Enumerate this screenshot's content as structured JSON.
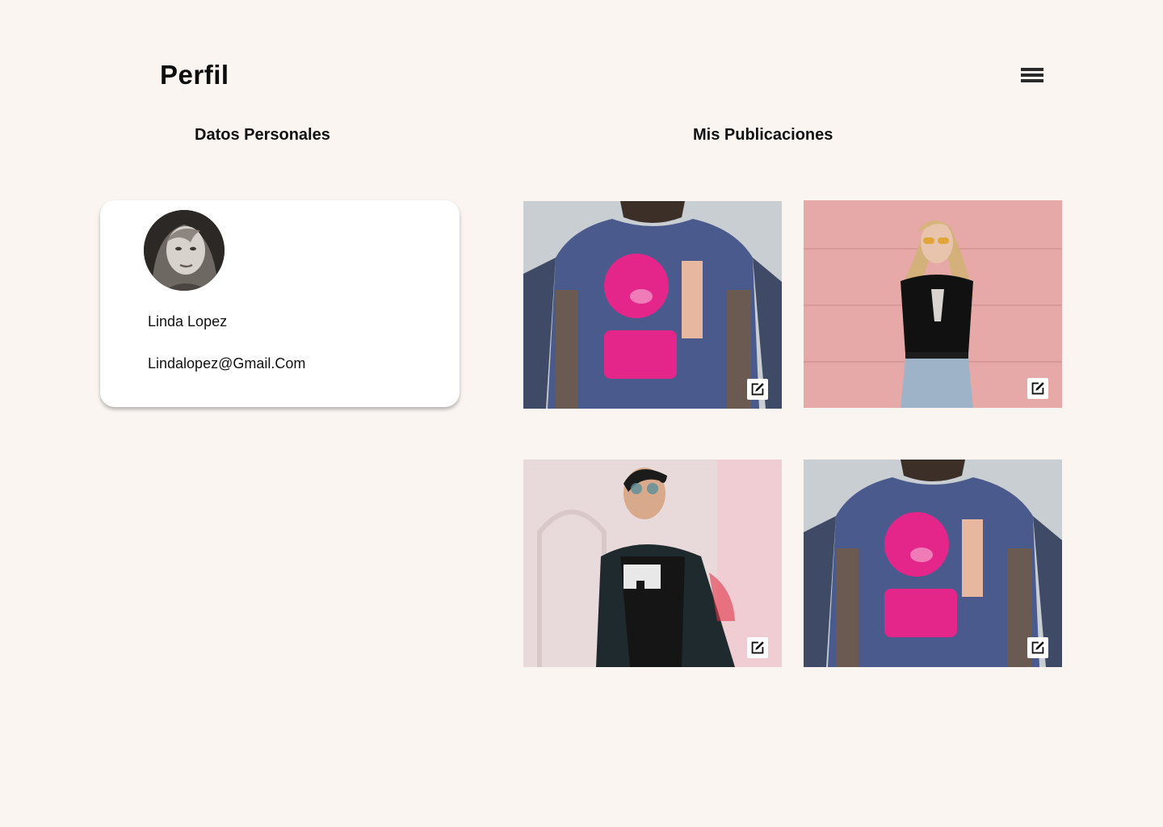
{
  "header": {
    "title": "Perfil",
    "menu_icon": "hamburger-menu-icon"
  },
  "sections": {
    "personal_title": "Datos Personales",
    "posts_title": "Mis Publicaciones"
  },
  "profile": {
    "name": "Linda Lopez",
    "email": "Lindalopez@Gmail.Com"
  },
  "posts": [
    {
      "subject": "man-blue-tshirt-pink-pig-print",
      "action_icon": "edit-icon"
    },
    {
      "subject": "woman-black-tshirt-pink-wall",
      "action_icon": "edit-icon"
    },
    {
      "subject": "man-black-jacket-sunglasses",
      "action_icon": "edit-icon"
    },
    {
      "subject": "man-blue-tshirt-pink-pig-print",
      "action_icon": "edit-icon"
    }
  ],
  "colors": {
    "background": "#faf5f1",
    "card": "#ffffff",
    "text": "#111111",
    "shirt_blue": "#4a5a8c",
    "print_pink": "#e4268a",
    "wall_pink": "#e7a8a8"
  }
}
